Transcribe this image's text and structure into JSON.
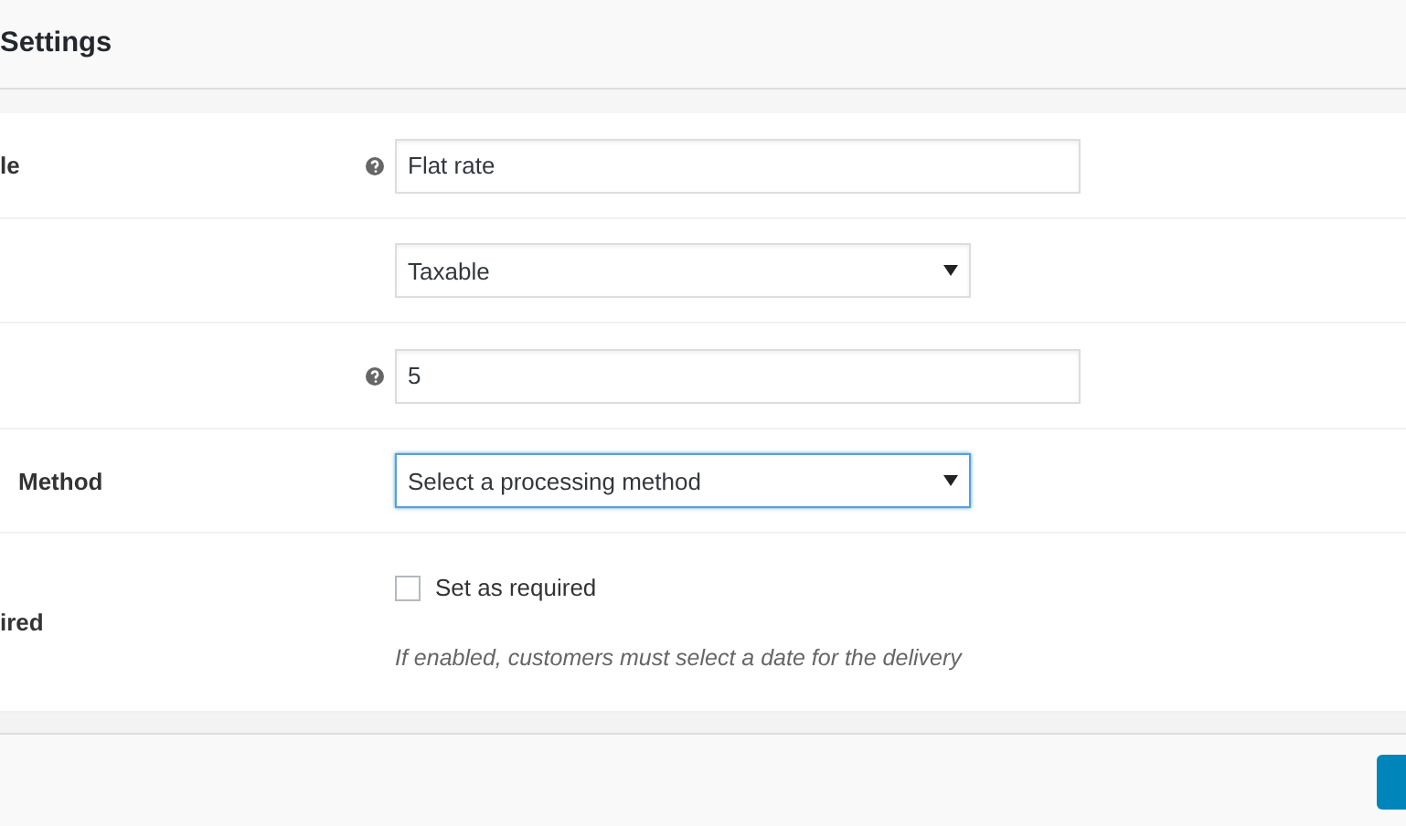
{
  "header": {
    "title": "Settings"
  },
  "rows": [
    {
      "kind": "text",
      "label": "le",
      "help": true,
      "value": "Flat rate"
    },
    {
      "kind": "select",
      "label": "",
      "help": false,
      "value": "Taxable",
      "focused": false
    },
    {
      "kind": "text",
      "label": "",
      "help": true,
      "value": "5"
    },
    {
      "kind": "select",
      "label": "Method",
      "help": false,
      "value": "Select a processing method",
      "focused": true
    },
    {
      "kind": "checkbox",
      "label": "ired",
      "help": false,
      "value": "Set as required",
      "checked": false,
      "description": "If enabled, customers must select a date for the delivery"
    }
  ],
  "footer": {
    "button": true
  }
}
